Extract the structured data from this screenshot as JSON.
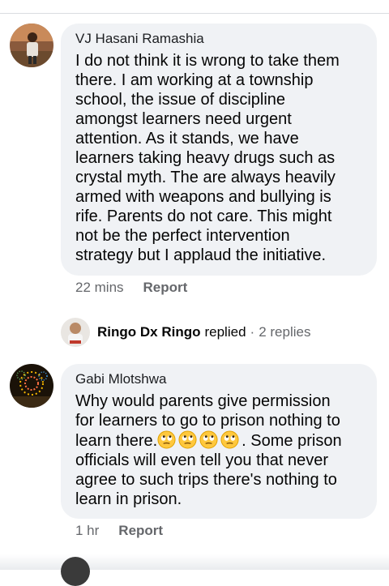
{
  "comments": [
    {
      "author": "VJ Hasani Ramashia",
      "text": "I do not think it is wrong to take them\nthere. I am working at a township\nschool, the issue of discipline\namongst learners need urgent\nattention. As it stands, we have\nlearners taking heavy drugs such as\ncrystal myth. The are always heavily\narmed with weapons and bullying is\nrife. Parents do not care. This might\nnot be the perfect intervention\nstrategy but I applaud the initiative.",
      "time": "22 mins",
      "report_label": "Report"
    },
    {
      "author": "Gabi Mlotshwa",
      "text_before_emoji": "Why would parents give permission\nfor learners to go to prison nothing to\nlearn there.",
      "emoji": "face-with-rolling-eyes",
      "emoji_count": 4,
      "text_after_emoji": ". Some prison\nofficials will even tell you that never\nagree to such trips there's nothing to\nlearn in prison.",
      "time": "1 hr",
      "report_label": "Report"
    }
  ],
  "reply_thread": {
    "name": "Ringo Dx Ringo",
    "replied_word": "replied",
    "separator": "·",
    "reply_count": "2 replies"
  },
  "colors": {
    "bubble": "#f0f2f5",
    "secondary_text": "#65676b",
    "primary_text": "#050505"
  }
}
